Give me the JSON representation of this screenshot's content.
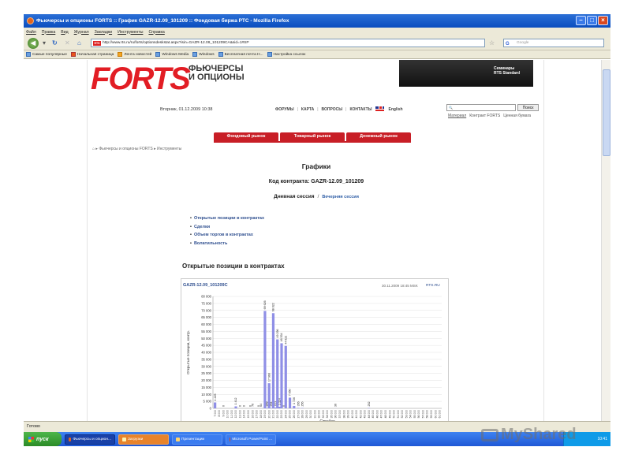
{
  "browser": {
    "title": "Фьючерсы и опционы FORTS :: График GAZR-12.09_101209 :: Фондовая биржа РТС - Mozilla Firefox",
    "menu": [
      "Файл",
      "Правка",
      "Вид",
      "Журнал",
      "Закладки",
      "Инструменты",
      "Справка"
    ],
    "url": "http://www.rts.ru/ru/forts/optionsdeskstat.aspx?isin=GAZR-12.09_101209CA&sid=1#SP",
    "search_placeholder": "Google",
    "bookmarks": [
      "Самые популярные",
      "Начальная страница",
      "Лента новостей",
      "Windows Media",
      "Windows",
      "Бесплатная почта H...",
      "Настройка ссылок"
    ],
    "status": "Готово"
  },
  "header": {
    "logo": "FORTS",
    "logo_sub_1": "ФЬЮЧЕРСЫ",
    "logo_sub_2": "И ОПЦИОНЫ",
    "seminars_1": "Семинары",
    "seminars_2": "RTS Standard",
    "date": "Вторник, 01.12.2009 10:38",
    "nav": [
      "ФОРУМЫ",
      "КАРТА",
      "ВОПРОСЫ",
      "КОНТАКТЫ"
    ],
    "lang": "English",
    "search_button": "Поиск",
    "site_links": [
      "Материал",
      "Контракт FORTS",
      "Ценная бумага"
    ]
  },
  "market_tabs": [
    "Фондовый рынок",
    "Товарный рынок",
    "Денежный рынок"
  ],
  "breadcrumb": "Фьючерсы и опционы FORTS ▸ Инструменты",
  "main": {
    "title": "Графики",
    "contract": "Код контракта: GAZR-12.09_101209",
    "session_day": "Дневная сессия",
    "session_sep": "/",
    "session_evening": "Вечерняя сессия",
    "links": [
      "Открытые позиции в контрактах",
      "Сделки",
      "Объем торгов в контрактах",
      "Волатильность"
    ],
    "section_title": "Открытые позиции в контрактах"
  },
  "chart_header": {
    "code": "GAZR-12.09_101209C",
    "datetime": "30.11.2009 18:45 MSK",
    "source": "RTS.RU"
  },
  "chart_data": {
    "type": "bar",
    "ylabel": "Открытые позиции, контр.",
    "xlabel": "Страйки",
    "ylim": [
      0,
      80000
    ],
    "yticks": [
      "0",
      "5 000",
      "10 000",
      "15 000",
      "20 000",
      "25 000",
      "30 000",
      "35 000",
      "40 000",
      "45 000",
      "50 000",
      "55 000",
      "60 000",
      "65 000",
      "70 000",
      "75 000",
      "80 000"
    ],
    "grid": true,
    "categories": [
      "7 000",
      "8 000",
      "9 000",
      "10 000",
      "11 000",
      "12 000",
      "13 000",
      "14 000",
      "15 000",
      "16 000",
      "17 000",
      "18 000",
      "19 000",
      "20 000",
      "21 000",
      "22 000",
      "23 000",
      "24 000",
      "25 000",
      "26 000",
      "27 000",
      "28 000",
      "29 000",
      "30 000",
      "31 000",
      "32 000",
      "33 000",
      "34 000",
      "35 000",
      "36 000",
      "37 000",
      "38 000",
      "39 000",
      "40 000",
      "41 000",
      "42 000",
      "43 000",
      "44 000",
      "45 000",
      "46 000",
      "47 000",
      "48 000",
      "49 000",
      "50 000",
      "51 000",
      "52 000",
      "53 000",
      "54 000",
      "55 000",
      "56 000",
      "57 000",
      "58 000",
      "59 000",
      "60 000",
      "61 000"
    ],
    "values": [
      4225,
      0,
      0,
      0,
      0,
      1412,
      0,
      0,
      0,
      0,
      0,
      0,
      0,
      0,
      0,
      0,
      0,
      0,
      0,
      0,
      0,
      0,
      0,
      0,
      0,
      0,
      0,
      0,
      0,
      0,
      0,
      0,
      0,
      0,
      0,
      0,
      0,
      0,
      0,
      0,
      0,
      0,
      0,
      0,
      0,
      0,
      0,
      0,
      0,
      0,
      0,
      0,
      0,
      0,
      0
    ],
    "series": [
      {
        "name": "Открытые позиции",
        "values": [
          {
            "x": "7 000",
            "y": 4225,
            "label": "4 225"
          },
          {
            "x": "9 000",
            "y": 0,
            "label": "0"
          },
          {
            "x": "12 000",
            "y": 1412,
            "label": "1 412"
          },
          {
            "x": "13 000",
            "y": 0,
            "label": "0"
          },
          {
            "x": "14 000",
            "y": 0,
            "label": "0"
          },
          {
            "x": "15 500",
            "y": 0,
            "label": "0"
          },
          {
            "x": "16 000",
            "y": 76,
            "label": "76"
          },
          {
            "x": "17 500",
            "y": 0,
            "label": "0"
          },
          {
            "x": "18 000",
            "y": 64,
            "label": "64"
          },
          {
            "x": "19 000",
            "y": 69626,
            "label": "69 626"
          },
          {
            "x": "19 500",
            "y": 309,
            "label": "309"
          },
          {
            "x": "20 000",
            "y": 17960,
            "label": "17 960"
          },
          {
            "x": "20 500",
            "y": 254,
            "label": "254"
          },
          {
            "x": "21 000",
            "y": 68022,
            "label": "68 022"
          },
          {
            "x": "21 500",
            "y": 613,
            "label": "613"
          },
          {
            "x": "22 000",
            "y": 49296,
            "label": "49 296"
          },
          {
            "x": "22 500",
            "y": 1114,
            "label": "1 114"
          },
          {
            "x": "23 000",
            "y": 46534,
            "label": "46 534"
          },
          {
            "x": "23 500",
            "y": 0,
            "label": "0"
          },
          {
            "x": "24 000",
            "y": 44622,
            "label": "44 622"
          },
          {
            "x": "25 000",
            "y": 7650,
            "label": "7 650"
          },
          {
            "x": "26 000",
            "y": 1726,
            "label": "1 726"
          },
          {
            "x": "27 000",
            "y": 356,
            "label": "356"
          },
          {
            "x": "28 000",
            "y": 256,
            "label": "256"
          },
          {
            "x": "36 000",
            "y": 36,
            "label": "36"
          },
          {
            "x": "44 000",
            "y": 252,
            "label": "252"
          }
        ]
      }
    ]
  },
  "taskbar": {
    "start": "пуск",
    "tasks": [
      "Фьючерсы и опцион...",
      "Загрузки",
      "Презентации",
      "Microsoft PowerPoint ..."
    ],
    "clock": "10:41"
  },
  "watermark": "MyShared"
}
